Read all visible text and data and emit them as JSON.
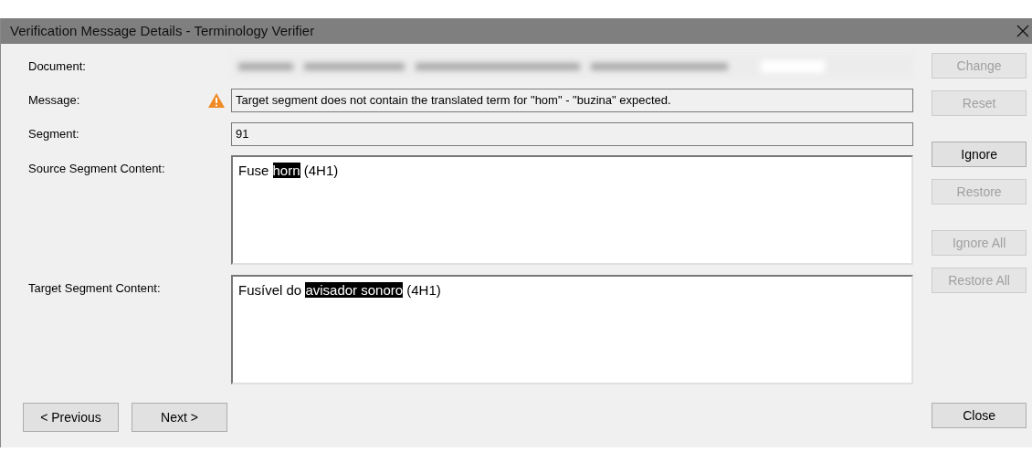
{
  "window": {
    "title": "Verification Message Details - Terminology Verifier"
  },
  "fields": [
    {
      "label": "Document:",
      "kind": "blurred"
    },
    {
      "label": "Message:",
      "kind": "message",
      "value": "Target segment does not contain the translated term for \"hom\" - \"buzina\" expected."
    },
    {
      "label": "Segment:",
      "kind": "text",
      "value": "91"
    }
  ],
  "contents": [
    {
      "label": "Source Segment Content:",
      "segments": [
        {
          "text": "Fuse ",
          "selected": false
        },
        {
          "text": "horn",
          "selected": true
        },
        {
          "text": " (4H1)",
          "selected": false
        }
      ]
    },
    {
      "label": "Target Segment Content:",
      "segments": [
        {
          "text": "Fusível do ",
          "selected": false
        },
        {
          "text": "avisador sonoro",
          "selected": true
        },
        {
          "text": " (4H1)",
          "selected": false
        }
      ]
    }
  ],
  "side_buttons": [
    {
      "label": "Change",
      "disabled": true
    },
    {
      "label": "Reset",
      "disabled": true
    },
    {
      "label": "Ignore",
      "disabled": false
    },
    {
      "label": "Restore",
      "disabled": true
    },
    {
      "label": "Ignore All",
      "disabled": true
    },
    {
      "label": "Restore All",
      "disabled": true
    }
  ],
  "nav_buttons": [
    {
      "label": "< Previous",
      "disabled": false
    },
    {
      "label": "Next >",
      "disabled": false
    }
  ],
  "close_button": {
    "label": "Close",
    "disabled": false
  }
}
